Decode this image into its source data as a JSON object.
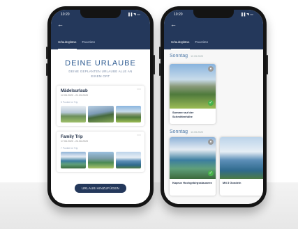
{
  "status": {
    "time": "10:20",
    "icons": "▐▐ ◥ ▭"
  },
  "tabs": {
    "plans": "Urlaubspläne",
    "favorites": "Favoriten"
  },
  "left": {
    "title": "DEINE URLAUBE",
    "subtitle": "DEINE GEPLANTEN URLAUBE ALLE AN EINEM ORT",
    "trips": [
      {
        "title": "Mädelsurlaub",
        "dates": "12.05.2020 - 21.05.2020",
        "sublabel": "5 Punkte im Trip"
      },
      {
        "title": "Family Trip",
        "dates": "17.06.2020 - 24.06.2020",
        "sublabel": "7 Punkte im Trip"
      }
    ],
    "cta": "URLAUB HINZUFÜGEN"
  },
  "right": {
    "days": [
      {
        "label": "Sonntag",
        "date": "12.05.2020"
      },
      {
        "label": "Sonntag",
        "date": "13.05.2020"
      }
    ],
    "pois": [
      "Sommer auf der Schmittenhöhe",
      "Kaprun Hochgebirgsstauseen",
      "Mit 3 Gondeln"
    ]
  },
  "icons": {
    "back": "arrow-left-icon",
    "more": "more-dots-icon",
    "check": "check-icon",
    "pin": "pin-icon"
  },
  "colors": {
    "header": "#24385b",
    "accent": "#2f5c92",
    "check": "#47b34a"
  }
}
